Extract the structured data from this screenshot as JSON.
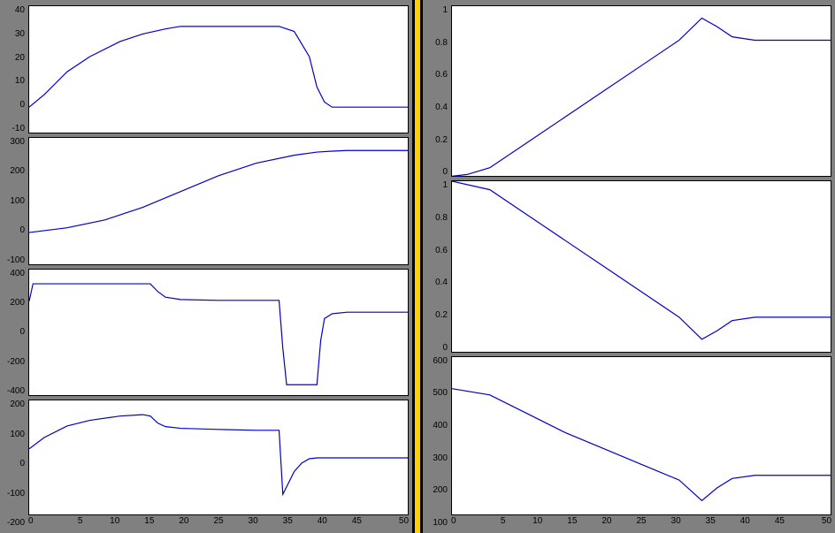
{
  "chart_data": [
    {
      "id": "L1",
      "type": "line",
      "xlim": [
        0,
        50
      ],
      "ylim": [
        -10,
        40
      ],
      "xticks": [
        0,
        5,
        10,
        15,
        20,
        25,
        30,
        35,
        40,
        45,
        50
      ],
      "yticks": [
        -10,
        0,
        10,
        20,
        30,
        40
      ],
      "series": [
        {
          "x": [
            0,
            2,
            5,
            8,
            12,
            15,
            18,
            20,
            25,
            30,
            33,
            35,
            37,
            38,
            39,
            40,
            42,
            45,
            50
          ],
          "y": [
            0,
            5,
            14,
            20,
            26,
            29,
            31,
            32,
            32,
            32,
            32,
            30,
            20,
            8,
            2,
            0,
            0,
            0,
            0
          ]
        }
      ]
    },
    {
      "id": "L2",
      "type": "line",
      "xlim": [
        0,
        50
      ],
      "ylim": [
        -100,
        300
      ],
      "xticks": [
        0,
        5,
        10,
        15,
        20,
        25,
        30,
        35,
        40,
        45,
        50
      ],
      "yticks": [
        -100,
        0,
        100,
        200,
        300
      ],
      "series": [
        {
          "x": [
            0,
            5,
            10,
            15,
            20,
            25,
            30,
            35,
            38,
            40,
            42,
            45,
            50
          ],
          "y": [
            0,
            15,
            40,
            80,
            130,
            180,
            220,
            245,
            255,
            258,
            260,
            260,
            260
          ]
        }
      ]
    },
    {
      "id": "L3",
      "type": "line",
      "xlim": [
        0,
        50
      ],
      "ylim": [
        -400,
        400
      ],
      "xticks": [
        0,
        5,
        10,
        15,
        20,
        25,
        30,
        35,
        40,
        45,
        50
      ],
      "yticks": [
        -400,
        -200,
        0,
        200,
        400
      ],
      "series": [
        {
          "x": [
            0,
            0.5,
            10,
            16,
            17,
            18,
            20,
            25,
            30,
            33,
            33.5,
            34,
            37,
            38,
            38.5,
            39,
            40,
            42,
            45,
            50
          ],
          "y": [
            200,
            310,
            310,
            310,
            260,
            225,
            210,
            205,
            205,
            205,
            -100,
            -330,
            -330,
            -330,
            -50,
            90,
            120,
            130,
            130,
            130
          ]
        }
      ]
    },
    {
      "id": "L4",
      "type": "line",
      "xlim": [
        0,
        50
      ],
      "ylim": [
        -200,
        200
      ],
      "xticks": [
        0,
        5,
        10,
        15,
        20,
        25,
        30,
        35,
        40,
        45,
        50
      ],
      "yticks": [
        -200,
        -100,
        0,
        100,
        200
      ],
      "series": [
        {
          "x": [
            0,
            2,
            5,
            8,
            12,
            15,
            16,
            17,
            18,
            20,
            25,
            30,
            33,
            33.5,
            35,
            36,
            37,
            38,
            40,
            42,
            45,
            50
          ],
          "y": [
            30,
            70,
            110,
            130,
            145,
            150,
            145,
            120,
            108,
            102,
            98,
            95,
            95,
            -130,
            -50,
            -20,
            -5,
            -2,
            -2,
            -2,
            -2,
            -2
          ]
        }
      ]
    },
    {
      "id": "R1",
      "type": "line",
      "xlim": [
        0,
        50
      ],
      "ylim": [
        0,
        1
      ],
      "xticks": [
        0,
        5,
        10,
        15,
        20,
        25,
        30,
        35,
        40,
        45,
        50
      ],
      "yticks": [
        0,
        0.2,
        0.4,
        0.6,
        0.8,
        1
      ],
      "series": [
        {
          "x": [
            0,
            2,
            5,
            10,
            15,
            20,
            25,
            30,
            33,
            35,
            37,
            40,
            45,
            50
          ],
          "y": [
            0,
            0.01,
            0.05,
            0.2,
            0.35,
            0.5,
            0.65,
            0.8,
            0.93,
            0.88,
            0.82,
            0.8,
            0.8,
            0.8
          ]
        }
      ]
    },
    {
      "id": "R2",
      "type": "line",
      "xlim": [
        0,
        50
      ],
      "ylim": [
        0,
        1
      ],
      "xticks": [
        0,
        5,
        10,
        15,
        20,
        25,
        30,
        35,
        40,
        45,
        50
      ],
      "yticks": [
        0,
        0.2,
        0.4,
        0.6,
        0.8,
        1
      ],
      "series": [
        {
          "x": [
            0,
            5,
            10,
            15,
            20,
            25,
            30,
            33,
            35,
            37,
            40,
            45,
            50
          ],
          "y": [
            1,
            0.95,
            0.8,
            0.65,
            0.5,
            0.35,
            0.2,
            0.07,
            0.12,
            0.18,
            0.2,
            0.2,
            0.2
          ]
        }
      ]
    },
    {
      "id": "R3",
      "type": "line",
      "xlim": [
        0,
        50
      ],
      "ylim": [
        100,
        600
      ],
      "xticks": [
        0,
        5,
        10,
        15,
        20,
        25,
        30,
        35,
        40,
        45,
        50
      ],
      "yticks": [
        100,
        200,
        300,
        400,
        500,
        600
      ],
      "series": [
        {
          "x": [
            0,
            5,
            10,
            15,
            20,
            25,
            30,
            33,
            35,
            37,
            40,
            45,
            50
          ],
          "y": [
            500,
            480,
            420,
            360,
            310,
            260,
            210,
            145,
            185,
            215,
            225,
            225,
            225
          ]
        }
      ]
    }
  ],
  "layout": {
    "left_ids": [
      "L1",
      "L2",
      "L3",
      "L4"
    ],
    "right_ids": [
      "R1",
      "R2",
      "R3"
    ]
  }
}
